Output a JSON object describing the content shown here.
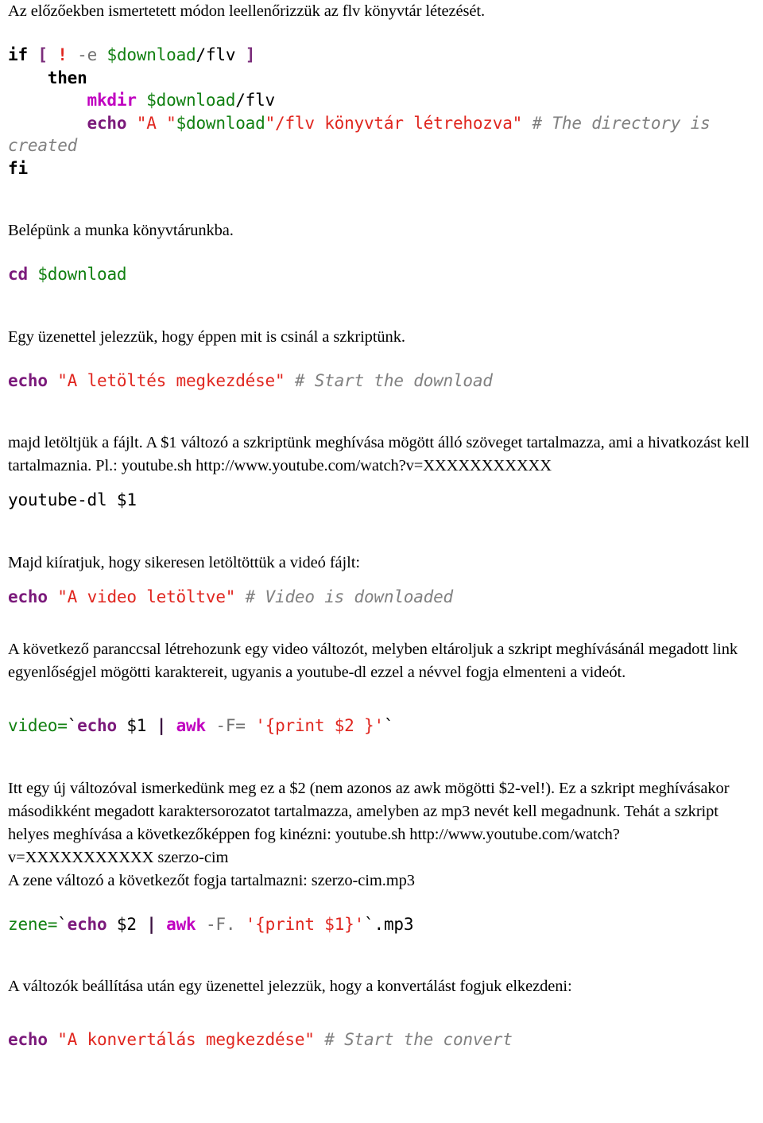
{
  "document": {
    "language": "hu",
    "colors": {
      "builtin": "#7b1a7b",
      "command": "#c000c0",
      "variable": "#118011",
      "string": "#e0261f",
      "comment": "#808080",
      "bracket": "#7b2d7b",
      "flag": "#707070",
      "text": "#000000",
      "background": "#ffffff"
    },
    "blocks": [
      {
        "kind": "prose",
        "text": "Az előzőekben ismertetett módon leellenőrizzük az flv könyvtár létezését."
      },
      {
        "kind": "code",
        "lines": [
          "if [ ! -e $download/flv ]",
          "    then",
          "        mkdir $download/flv",
          "        echo \"A \"$download\"/flv könyvtár létrehozva\" # The directory is created",
          "fi"
        ]
      },
      {
        "kind": "prose",
        "text": "Belépünk a munka könyvtárunkba."
      },
      {
        "kind": "code",
        "lines": [
          "cd $download"
        ]
      },
      {
        "kind": "prose",
        "text": "Egy üzenettel jelezzük, hogy éppen mit is csinál a szkriptünk."
      },
      {
        "kind": "code",
        "lines": [
          "echo \"A letöltés megkezdése\" # Start the download"
        ]
      },
      {
        "kind": "prose",
        "text": "majd letöltjük a fájlt. A $1 változó a szkriptünk meghívása mögött álló szöveget tartalmazza, ami a hivatkozást kell tartalmaznia. Pl.: youtube.sh http://www.youtube.com/watch?v=XXXXXXXXXXX"
      },
      {
        "kind": "code",
        "lines": [
          "youtube-dl $1"
        ]
      },
      {
        "kind": "prose",
        "text": "Majd kiíratjuk, hogy sikeresen letöltöttük a videó fájlt:"
      },
      {
        "kind": "code",
        "lines": [
          "echo \"A video letöltve\" # Video is downloaded"
        ]
      },
      {
        "kind": "prose",
        "text": "A következő paranccsal létrehozunk egy video változót, melyben eltároljuk a szkript meghívásánál megadott link egyenlőségjel mögötti karaktereit, ugyanis a youtube-dl ezzel a névvel fogja elmenteni a videót."
      },
      {
        "kind": "code",
        "lines": [
          "video=`echo $1 | awk -F= '{print $2 }'`"
        ]
      },
      {
        "kind": "prose",
        "text": "Itt egy új változóval ismerkedünk meg ez a $2 (nem azonos az awk mögötti $2-vel!). Ez a szkript meghívásakor másodikként megadott karaktersorozatot tartalmazza, amelyben az mp3 nevét kell megadnunk. Tehát a szkript helyes meghívása a következőképpen fog kinézni: youtube.sh http://www.youtube.com/watch?v=XXXXXXXXXXX szerzo-cim"
      },
      {
        "kind": "prose",
        "text": "A zene változó a következőt fogja tartalmazni: szerzo-cim.mp3"
      },
      {
        "kind": "code",
        "lines": [
          "zene=`echo $2 | awk -F. '{print $1}'`.mp3"
        ]
      },
      {
        "kind": "prose",
        "text": "A változók beállítása után egy üzenettel jelezzük, hogy a konvertálást fogjuk elkezdeni:"
      },
      {
        "kind": "code",
        "lines": [
          "echo \"A konvertálás megkezdése\" # Start the convert"
        ]
      }
    ],
    "tokens": {
      "p1": "Az előzőekben ismertetett módon leellenőrizzük az flv könyvtár létezését.",
      "p2": "Belépünk a munka könyvtárunkba.",
      "p3": "Egy üzenettel jelezzük, hogy éppen mit is csinál a szkriptünk.",
      "p4": "majd letöltjük a fájlt. A $1 változó a szkriptünk meghívása mögött álló szöveget tartalmazza, ami a hivatkozást kell tartalmaznia. Pl.: youtube.sh http://www.youtube.com/watch?v=XXXXXXXXXXX",
      "p5": "Majd kiíratjuk, hogy sikeresen letöltöttük a videó fájlt:",
      "p6": "A következő paranccsal létrehozunk egy video változót, melyben eltároljuk a szkript meghívásánál megadott link egyenlőségjel mögötti karaktereit, ugyanis a youtube-dl ezzel a névvel fogja elmenteni a videót.",
      "p7": "Itt egy új változóval ismerkedünk meg ez a $2 (nem azonos az awk mögötti $2-vel!). Ez a szkript meghívásakor másodikként megadott karaktersorozatot tartalmazza, amelyben az mp3 nevét kell megadnunk. Tehát a szkript helyes meghívása a következőképpen fog kinézni: youtube.sh http://www.youtube.com/watch?v=XXXXXXXXXXX szerzo-cim",
      "p8": "A zene változó a következőt fogja tartalmazni: szerzo-cim.mp3",
      "p9": "A változók beállítása után egy üzenettel jelezzük, hogy a konvertálást fogjuk elkezdeni:",
      "c1_if": "if",
      "c1_open_bracket": "[",
      "c1_bang": "!",
      "c1_flag_e": "-e",
      "c1_var_download": "$download",
      "c1_path_flv": "/flv",
      "c1_close_bracket": "]",
      "c1_then": "then",
      "c1_mkdir": "mkdir",
      "c1_mkdir_var": "$download",
      "c1_mkdir_path": "/flv",
      "c1_echo": "echo",
      "c1_str_a": "\"A \"",
      "c1_echo_var": "$download",
      "c1_str_b": "\"/flv könyvtár létrehozva\"",
      "c1_comment": "# The directory is created",
      "c1_fi": "fi",
      "c2_cd": "cd",
      "c2_var": "$download",
      "c3_echo": "echo",
      "c3_str": "\"A letöltés megkezdése\"",
      "c3_comment": "# Start the download",
      "c4_cmd": "youtube-dl $1",
      "c5_echo": "echo",
      "c5_str": "\"A video letöltve\"",
      "c5_comment": "# Video is downloaded",
      "c6_assign": "video=",
      "c6_tick_open": "`",
      "c6_echo": "echo",
      "c6_arg": " $1 ",
      "c6_pipe": "|",
      "c6_awk": "awk",
      "c6_flag": "-F=",
      "c6_str": "'{print $2 }'",
      "c6_tick_close": "`",
      "c7_assign": "zene=",
      "c7_tick_open": "`",
      "c7_echo": "echo",
      "c7_arg": " $2 ",
      "c7_pipe": "|",
      "c7_awk": "awk",
      "c7_flag": "-F.",
      "c7_str": "'{print $1}'",
      "c7_tick_close": "`",
      "c7_suffix": ".mp3",
      "c8_echo": "echo",
      "c8_str": "\"A konvertálás megkezdése\"",
      "c8_comment": "# Start the convert"
    }
  }
}
